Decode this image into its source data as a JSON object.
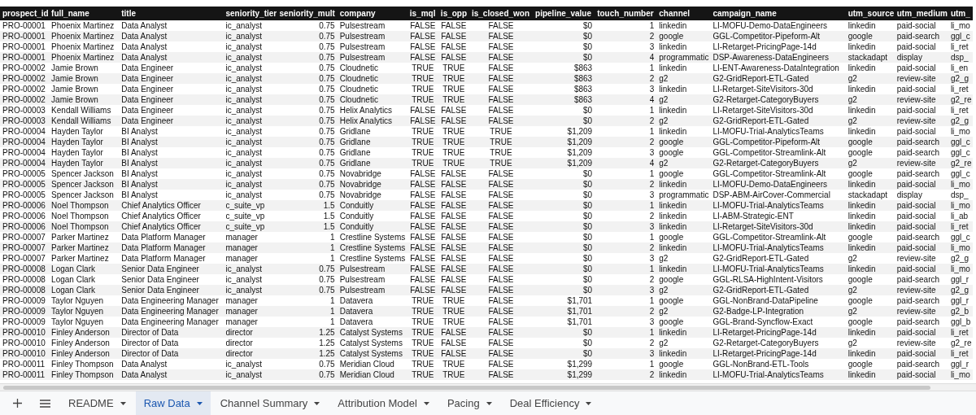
{
  "table": {
    "columns": [
      {
        "label": "prospect_id",
        "kind": "text"
      },
      {
        "label": "full_name",
        "kind": "text"
      },
      {
        "label": "title",
        "kind": "text"
      },
      {
        "label": "seniority_tier",
        "kind": "text"
      },
      {
        "label": "seniority_mult",
        "kind": "number"
      },
      {
        "label": "company",
        "kind": "text"
      },
      {
        "label": "is_mql",
        "kind": "boolean"
      },
      {
        "label": "is_opp",
        "kind": "boolean"
      },
      {
        "label": "is_closed_won",
        "kind": "boolean"
      },
      {
        "label": "pipeline_value",
        "kind": "number"
      },
      {
        "label": "touch_number",
        "kind": "number"
      },
      {
        "label": "channel",
        "kind": "text"
      },
      {
        "label": "campaign_name",
        "kind": "text"
      },
      {
        "label": "utm_source",
        "kind": "text"
      },
      {
        "label": "utm_medium",
        "kind": "text"
      },
      {
        "label": "utm_",
        "kind": "text"
      }
    ],
    "rows": [
      [
        "PRO-00001",
        "Phoenix Martinez",
        "Data Analyst",
        "ic_analyst",
        "0.75",
        "Pulsestream",
        "FALSE",
        "FALSE",
        "FALSE",
        "$0",
        "1",
        "linkedin",
        "LI-MOFU-Demo-DataEngineers",
        "linkedin",
        "paid-social",
        "li_mo"
      ],
      [
        "PRO-00001",
        "Phoenix Martinez",
        "Data Analyst",
        "ic_analyst",
        "0.75",
        "Pulsestream",
        "FALSE",
        "FALSE",
        "FALSE",
        "$0",
        "2",
        "google",
        "GGL-Competitor-Pipeform-Alt",
        "google",
        "paid-search",
        "ggl_c"
      ],
      [
        "PRO-00001",
        "Phoenix Martinez",
        "Data Analyst",
        "ic_analyst",
        "0.75",
        "Pulsestream",
        "FALSE",
        "FALSE",
        "FALSE",
        "$0",
        "3",
        "linkedin",
        "LI-Retarget-PricingPage-14d",
        "linkedin",
        "paid-social",
        "li_ret"
      ],
      [
        "PRO-00001",
        "Phoenix Martinez",
        "Data Analyst",
        "ic_analyst",
        "0.75",
        "Pulsestream",
        "FALSE",
        "FALSE",
        "FALSE",
        "$0",
        "4",
        "programmatic",
        "DSP-Awareness-DataEngineers",
        "stackadapt",
        "display",
        "dsp_"
      ],
      [
        "PRO-00002",
        "Jamie Brown",
        "Data Engineer",
        "ic_analyst",
        "0.75",
        "Cloudnetic",
        "TRUE",
        "TRUE",
        "FALSE",
        "$863",
        "1",
        "linkedin",
        "LI-ENT-Awareness-DataIntegration",
        "linkedin",
        "paid-social",
        "li_en"
      ],
      [
        "PRO-00002",
        "Jamie Brown",
        "Data Engineer",
        "ic_analyst",
        "0.75",
        "Cloudnetic",
        "TRUE",
        "TRUE",
        "FALSE",
        "$863",
        "2",
        "g2",
        "G2-GridReport-ETL-Gated",
        "g2",
        "review-site",
        "g2_g"
      ],
      [
        "PRO-00002",
        "Jamie Brown",
        "Data Engineer",
        "ic_analyst",
        "0.75",
        "Cloudnetic",
        "TRUE",
        "TRUE",
        "FALSE",
        "$863",
        "3",
        "linkedin",
        "LI-Retarget-SiteVisitors-30d",
        "linkedin",
        "paid-social",
        "li_ret"
      ],
      [
        "PRO-00002",
        "Jamie Brown",
        "Data Engineer",
        "ic_analyst",
        "0.75",
        "Cloudnetic",
        "TRUE",
        "TRUE",
        "FALSE",
        "$863",
        "4",
        "g2",
        "G2-Retarget-CategoryBuyers",
        "g2",
        "review-site",
        "g2_re"
      ],
      [
        "PRO-00003",
        "Kendall Williams",
        "Data Engineer",
        "ic_analyst",
        "0.75",
        "Helix Analytics",
        "FALSE",
        "FALSE",
        "FALSE",
        "$0",
        "1",
        "linkedin",
        "LI-Retarget-SiteVisitors-30d",
        "linkedin",
        "paid-social",
        "li_ret"
      ],
      [
        "PRO-00003",
        "Kendall Williams",
        "Data Engineer",
        "ic_analyst",
        "0.75",
        "Helix Analytics",
        "FALSE",
        "FALSE",
        "FALSE",
        "$0",
        "2",
        "g2",
        "G2-GridReport-ETL-Gated",
        "g2",
        "review-site",
        "g2_g"
      ],
      [
        "PRO-00004",
        "Hayden Taylor",
        "BI Analyst",
        "ic_analyst",
        "0.75",
        "Gridlane",
        "TRUE",
        "TRUE",
        "TRUE",
        "$1,209",
        "1",
        "linkedin",
        "LI-MOFU-Trial-AnalyticsTeams",
        "linkedin",
        "paid-social",
        "li_mo"
      ],
      [
        "PRO-00004",
        "Hayden Taylor",
        "BI Analyst",
        "ic_analyst",
        "0.75",
        "Gridlane",
        "TRUE",
        "TRUE",
        "TRUE",
        "$1,209",
        "2",
        "google",
        "GGL-Competitor-Pipeform-Alt",
        "google",
        "paid-search",
        "ggl_c"
      ],
      [
        "PRO-00004",
        "Hayden Taylor",
        "BI Analyst",
        "ic_analyst",
        "0.75",
        "Gridlane",
        "TRUE",
        "TRUE",
        "TRUE",
        "$1,209",
        "3",
        "google",
        "GGL-Competitor-Streamlink-Alt",
        "google",
        "paid-search",
        "ggl_c"
      ],
      [
        "PRO-00004",
        "Hayden Taylor",
        "BI Analyst",
        "ic_analyst",
        "0.75",
        "Gridlane",
        "TRUE",
        "TRUE",
        "TRUE",
        "$1,209",
        "4",
        "g2",
        "G2-Retarget-CategoryBuyers",
        "g2",
        "review-site",
        "g2_re"
      ],
      [
        "PRO-00005",
        "Spencer Jackson",
        "BI Analyst",
        "ic_analyst",
        "0.75",
        "Novabridge",
        "FALSE",
        "FALSE",
        "FALSE",
        "$0",
        "1",
        "google",
        "GGL-Competitor-Streamlink-Alt",
        "google",
        "paid-search",
        "ggl_c"
      ],
      [
        "PRO-00005",
        "Spencer Jackson",
        "BI Analyst",
        "ic_analyst",
        "0.75",
        "Novabridge",
        "FALSE",
        "FALSE",
        "FALSE",
        "$0",
        "2",
        "linkedin",
        "LI-MOFU-Demo-DataEngineers",
        "linkedin",
        "paid-social",
        "li_mo"
      ],
      [
        "PRO-00005",
        "Spencer Jackson",
        "BI Analyst",
        "ic_analyst",
        "0.75",
        "Novabridge",
        "FALSE",
        "FALSE",
        "FALSE",
        "$0",
        "3",
        "programmatic",
        "DSP-ABM-AirCover-Commercial",
        "stackadapt",
        "display",
        "dsp_"
      ],
      [
        "PRO-00006",
        "Noel Thompson",
        "Chief Analytics Officer",
        "c_suite_vp",
        "1.5",
        "Conduitly",
        "FALSE",
        "FALSE",
        "FALSE",
        "$0",
        "1",
        "linkedin",
        "LI-MOFU-Trial-AnalyticsTeams",
        "linkedin",
        "paid-social",
        "li_mo"
      ],
      [
        "PRO-00006",
        "Noel Thompson",
        "Chief Analytics Officer",
        "c_suite_vp",
        "1.5",
        "Conduitly",
        "FALSE",
        "FALSE",
        "FALSE",
        "$0",
        "2",
        "linkedin",
        "LI-ABM-Strategic-ENT",
        "linkedin",
        "paid-social",
        "li_ab"
      ],
      [
        "PRO-00006",
        "Noel Thompson",
        "Chief Analytics Officer",
        "c_suite_vp",
        "1.5",
        "Conduitly",
        "FALSE",
        "FALSE",
        "FALSE",
        "$0",
        "3",
        "linkedin",
        "LI-Retarget-SiteVisitors-30d",
        "linkedin",
        "paid-social",
        "li_ret"
      ],
      [
        "PRO-00007",
        "Parker Martinez",
        "Data Platform Manager",
        "manager",
        "1",
        "Crestline Systems",
        "FALSE",
        "FALSE",
        "FALSE",
        "$0",
        "1",
        "google",
        "GGL-Competitor-Streamlink-Alt",
        "google",
        "paid-search",
        "ggl_c"
      ],
      [
        "PRO-00007",
        "Parker Martinez",
        "Data Platform Manager",
        "manager",
        "1",
        "Crestline Systems",
        "FALSE",
        "FALSE",
        "FALSE",
        "$0",
        "2",
        "linkedin",
        "LI-MOFU-Trial-AnalyticsTeams",
        "linkedin",
        "paid-social",
        "li_mo"
      ],
      [
        "PRO-00007",
        "Parker Martinez",
        "Data Platform Manager",
        "manager",
        "1",
        "Crestline Systems",
        "FALSE",
        "FALSE",
        "FALSE",
        "$0",
        "3",
        "g2",
        "G2-GridReport-ETL-Gated",
        "g2",
        "review-site",
        "g2_g"
      ],
      [
        "PRO-00008",
        "Logan Clark",
        "Senior Data Engineer",
        "ic_analyst",
        "0.75",
        "Pulsestream",
        "FALSE",
        "FALSE",
        "FALSE",
        "$0",
        "1",
        "linkedin",
        "LI-MOFU-Trial-AnalyticsTeams",
        "linkedin",
        "paid-social",
        "li_mo"
      ],
      [
        "PRO-00008",
        "Logan Clark",
        "Senior Data Engineer",
        "ic_analyst",
        "0.75",
        "Pulsestream",
        "FALSE",
        "FALSE",
        "FALSE",
        "$0",
        "2",
        "google",
        "GGL-RLSA-HighIntent-Visitors",
        "google",
        "paid-search",
        "ggl_r"
      ],
      [
        "PRO-00008",
        "Logan Clark",
        "Senior Data Engineer",
        "ic_analyst",
        "0.75",
        "Pulsestream",
        "FALSE",
        "FALSE",
        "FALSE",
        "$0",
        "3",
        "g2",
        "G2-GridReport-ETL-Gated",
        "g2",
        "review-site",
        "g2_g"
      ],
      [
        "PRO-00009",
        "Taylor Nguyen",
        "Data Engineering Manager",
        "manager",
        "1",
        "Datavera",
        "TRUE",
        "TRUE",
        "FALSE",
        "$1,701",
        "1",
        "google",
        "GGL-NonBrand-DataPipeline",
        "google",
        "paid-search",
        "ggl_r"
      ],
      [
        "PRO-00009",
        "Taylor Nguyen",
        "Data Engineering Manager",
        "manager",
        "1",
        "Datavera",
        "TRUE",
        "TRUE",
        "FALSE",
        "$1,701",
        "2",
        "g2",
        "G2-Badge-LP-Integration",
        "g2",
        "review-site",
        "g2_b"
      ],
      [
        "PRO-00009",
        "Taylor Nguyen",
        "Data Engineering Manager",
        "manager",
        "1",
        "Datavera",
        "TRUE",
        "TRUE",
        "FALSE",
        "$1,701",
        "3",
        "google",
        "GGL-Brand-Syncflow-Exact",
        "google",
        "paid-search",
        "ggl_b"
      ],
      [
        "PRO-00010",
        "Finley Anderson",
        "Director of Data",
        "director",
        "1.25",
        "Catalyst Systems",
        "TRUE",
        "FALSE",
        "FALSE",
        "$0",
        "1",
        "linkedin",
        "LI-Retarget-PricingPage-14d",
        "linkedin",
        "paid-social",
        "li_ret"
      ],
      [
        "PRO-00010",
        "Finley Anderson",
        "Director of Data",
        "director",
        "1.25",
        "Catalyst Systems",
        "TRUE",
        "FALSE",
        "FALSE",
        "$0",
        "2",
        "g2",
        "G2-Retarget-CategoryBuyers",
        "g2",
        "review-site",
        "g2_re"
      ],
      [
        "PRO-00010",
        "Finley Anderson",
        "Director of Data",
        "director",
        "1.25",
        "Catalyst Systems",
        "TRUE",
        "FALSE",
        "FALSE",
        "$0",
        "3",
        "linkedin",
        "LI-Retarget-PricingPage-14d",
        "linkedin",
        "paid-social",
        "li_ret"
      ],
      [
        "PRO-00011",
        "Finley Thompson",
        "Data Analyst",
        "ic_analyst",
        "0.75",
        "Meridian Cloud",
        "TRUE",
        "TRUE",
        "FALSE",
        "$1,299",
        "1",
        "google",
        "GGL-NonBrand-ETL-Tools",
        "google",
        "paid-search",
        "ggl_r"
      ],
      [
        "PRO-00011",
        "Finley Thompson",
        "Data Analyst",
        "ic_analyst",
        "0.75",
        "Meridian Cloud",
        "TRUE",
        "TRUE",
        "FALSE",
        "$1,299",
        "2",
        "linkedin",
        "LI-MOFU-Trial-AnalyticsTeams",
        "linkedin",
        "paid-social",
        "li_mo"
      ]
    ]
  },
  "sheet_tabs": [
    {
      "label": "README",
      "selected": false
    },
    {
      "label": "Raw Data",
      "selected": true
    },
    {
      "label": "Channel Summary",
      "selected": false
    },
    {
      "label": "Attribution Model",
      "selected": false
    },
    {
      "label": "Pacing",
      "selected": false
    },
    {
      "label": "Deal Efficiency",
      "selected": false
    }
  ]
}
